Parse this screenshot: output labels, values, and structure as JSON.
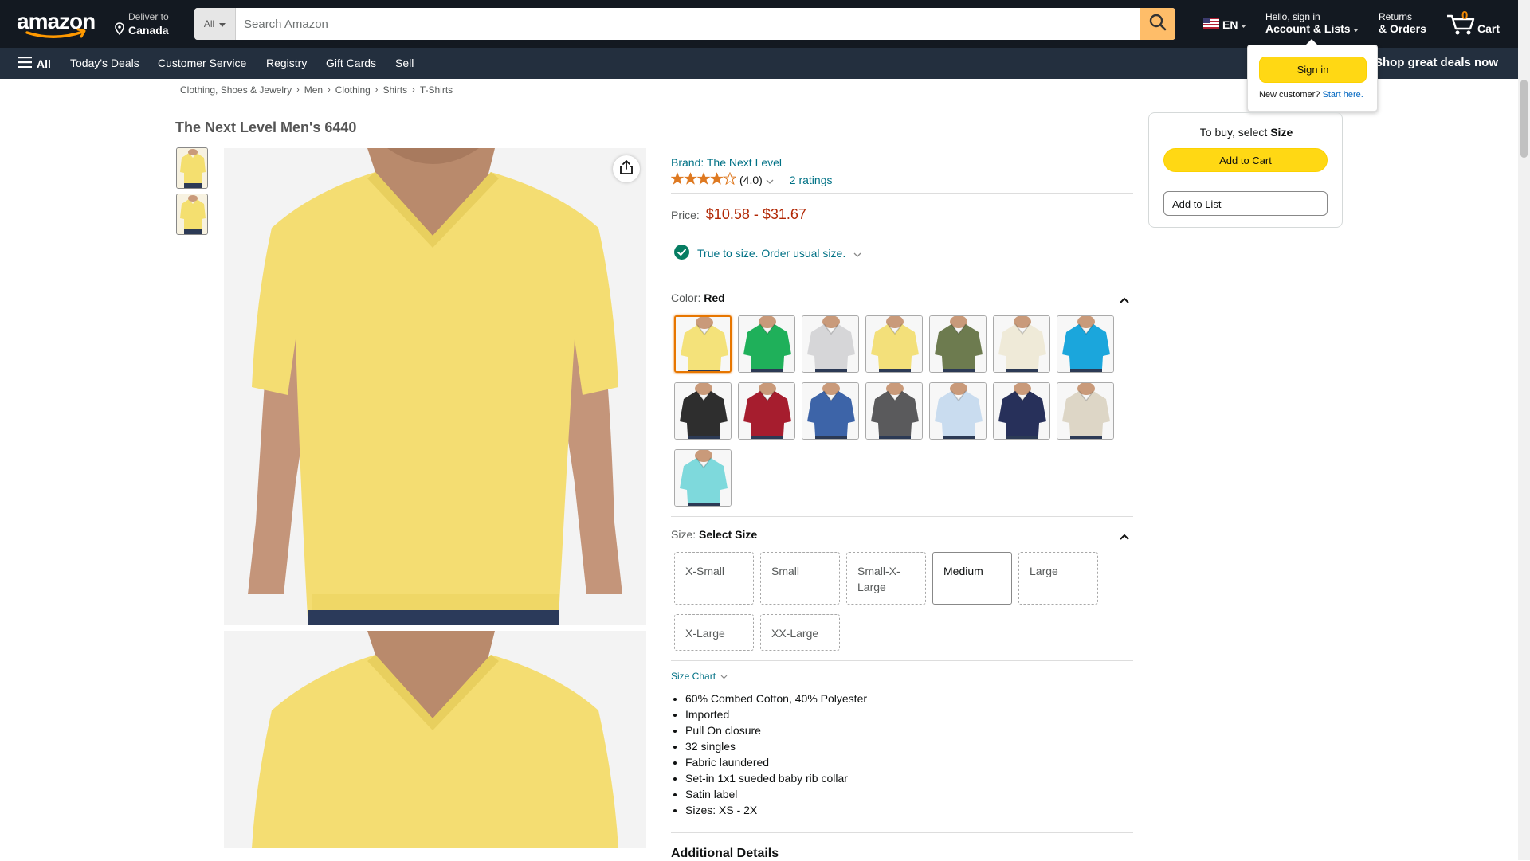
{
  "header": {
    "deliver_line1": "Deliver to",
    "deliver_line2": "Canada",
    "search_category": "All",
    "search_placeholder": "Search Amazon",
    "language": "EN",
    "account_line1": "Hello, sign in",
    "account_line2": "Account & Lists",
    "returns_line1": "Returns",
    "returns_line2": "& Orders",
    "cart_count": "0",
    "cart_label": "Cart"
  },
  "subnav": {
    "all_label": "All",
    "items": [
      "Today's Deals",
      "Customer Service",
      "Registry",
      "Gift Cards",
      "Sell"
    ],
    "promo": "Shop great deals now"
  },
  "signin_popover": {
    "button": "Sign in",
    "new_customer": "New customer?",
    "start_here": "Start here."
  },
  "breadcrumb": [
    "Clothing, Shoes & Jewelry",
    "Men",
    "Clothing",
    "Shirts",
    "T-Shirts"
  ],
  "product": {
    "title": "The Next Level Men's 6440",
    "brand": "Brand: The Next Level",
    "rating_value": "(4.0)",
    "ratings_count": "2 ratings",
    "price_label": "Price:",
    "price": "$10.58 - $31.67",
    "fit_note": "True to size. Order usual size.",
    "color_label": "Color:",
    "color_selected": "Red",
    "size_label": "Size:",
    "size_selected": "Select Size",
    "sizes": [
      "X-Small",
      "Small",
      "Small-X-Large",
      "Medium",
      "Large",
      "X-Large",
      "XX-Large"
    ],
    "size_chart": "Size Chart",
    "features": [
      "60% Combed Cotton, 40% Polyester",
      "Imported",
      "Pull On closure",
      "32 singles",
      "Fabric laundered",
      "Set-in 1x1 sueded baby rib collar",
      "Satin label",
      "Sizes: XS - 2X"
    ],
    "additional_heading": "Additional Details"
  },
  "swatch_colors": [
    "#f4e27a",
    "#1fb05a",
    "#d6d6d8",
    "#f3e07a",
    "#6d7b4f",
    "#efead8",
    "#1ba6dc",
    "#2e2e2e",
    "#a61d2e",
    "#3d64a8",
    "#5a5a5c",
    "#c9dcef",
    "#27305a",
    "#ddd6c6",
    "#7ed9dc"
  ],
  "buybox": {
    "prompt": "To buy, select",
    "prompt_bold": "Size",
    "add_to_cart": "Add to Cart",
    "add_to_list": "Add to List"
  }
}
